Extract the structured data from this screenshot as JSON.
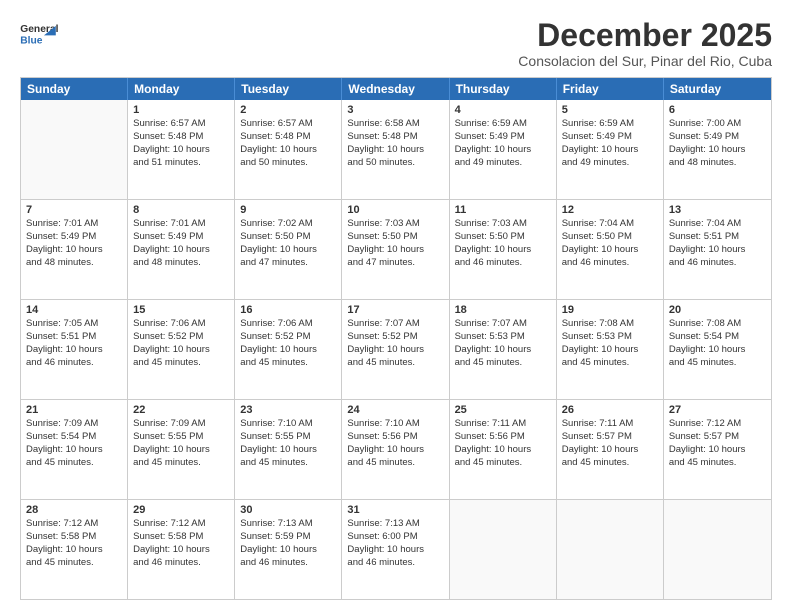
{
  "header": {
    "logo_general": "General",
    "logo_blue": "Blue",
    "title": "December 2025",
    "subtitle": "Consolacion del Sur, Pinar del Rio, Cuba"
  },
  "days_of_week": [
    "Sunday",
    "Monday",
    "Tuesday",
    "Wednesday",
    "Thursday",
    "Friday",
    "Saturday"
  ],
  "weeks": [
    [
      {
        "day": "",
        "empty": true
      },
      {
        "day": "1",
        "lines": [
          "Sunrise: 6:57 AM",
          "Sunset: 5:48 PM",
          "Daylight: 10 hours",
          "and 51 minutes."
        ]
      },
      {
        "day": "2",
        "lines": [
          "Sunrise: 6:57 AM",
          "Sunset: 5:48 PM",
          "Daylight: 10 hours",
          "and 50 minutes."
        ]
      },
      {
        "day": "3",
        "lines": [
          "Sunrise: 6:58 AM",
          "Sunset: 5:48 PM",
          "Daylight: 10 hours",
          "and 50 minutes."
        ]
      },
      {
        "day": "4",
        "lines": [
          "Sunrise: 6:59 AM",
          "Sunset: 5:49 PM",
          "Daylight: 10 hours",
          "and 49 minutes."
        ]
      },
      {
        "day": "5",
        "lines": [
          "Sunrise: 6:59 AM",
          "Sunset: 5:49 PM",
          "Daylight: 10 hours",
          "and 49 minutes."
        ]
      },
      {
        "day": "6",
        "lines": [
          "Sunrise: 7:00 AM",
          "Sunset: 5:49 PM",
          "Daylight: 10 hours",
          "and 48 minutes."
        ]
      }
    ],
    [
      {
        "day": "7",
        "lines": [
          "Sunrise: 7:01 AM",
          "Sunset: 5:49 PM",
          "Daylight: 10 hours",
          "and 48 minutes."
        ]
      },
      {
        "day": "8",
        "lines": [
          "Sunrise: 7:01 AM",
          "Sunset: 5:49 PM",
          "Daylight: 10 hours",
          "and 48 minutes."
        ]
      },
      {
        "day": "9",
        "lines": [
          "Sunrise: 7:02 AM",
          "Sunset: 5:50 PM",
          "Daylight: 10 hours",
          "and 47 minutes."
        ]
      },
      {
        "day": "10",
        "lines": [
          "Sunrise: 7:03 AM",
          "Sunset: 5:50 PM",
          "Daylight: 10 hours",
          "and 47 minutes."
        ]
      },
      {
        "day": "11",
        "lines": [
          "Sunrise: 7:03 AM",
          "Sunset: 5:50 PM",
          "Daylight: 10 hours",
          "and 46 minutes."
        ]
      },
      {
        "day": "12",
        "lines": [
          "Sunrise: 7:04 AM",
          "Sunset: 5:50 PM",
          "Daylight: 10 hours",
          "and 46 minutes."
        ]
      },
      {
        "day": "13",
        "lines": [
          "Sunrise: 7:04 AM",
          "Sunset: 5:51 PM",
          "Daylight: 10 hours",
          "and 46 minutes."
        ]
      }
    ],
    [
      {
        "day": "14",
        "lines": [
          "Sunrise: 7:05 AM",
          "Sunset: 5:51 PM",
          "Daylight: 10 hours",
          "and 46 minutes."
        ]
      },
      {
        "day": "15",
        "lines": [
          "Sunrise: 7:06 AM",
          "Sunset: 5:52 PM",
          "Daylight: 10 hours",
          "and 45 minutes."
        ]
      },
      {
        "day": "16",
        "lines": [
          "Sunrise: 7:06 AM",
          "Sunset: 5:52 PM",
          "Daylight: 10 hours",
          "and 45 minutes."
        ]
      },
      {
        "day": "17",
        "lines": [
          "Sunrise: 7:07 AM",
          "Sunset: 5:52 PM",
          "Daylight: 10 hours",
          "and 45 minutes."
        ]
      },
      {
        "day": "18",
        "lines": [
          "Sunrise: 7:07 AM",
          "Sunset: 5:53 PM",
          "Daylight: 10 hours",
          "and 45 minutes."
        ]
      },
      {
        "day": "19",
        "lines": [
          "Sunrise: 7:08 AM",
          "Sunset: 5:53 PM",
          "Daylight: 10 hours",
          "and 45 minutes."
        ]
      },
      {
        "day": "20",
        "lines": [
          "Sunrise: 7:08 AM",
          "Sunset: 5:54 PM",
          "Daylight: 10 hours",
          "and 45 minutes."
        ]
      }
    ],
    [
      {
        "day": "21",
        "lines": [
          "Sunrise: 7:09 AM",
          "Sunset: 5:54 PM",
          "Daylight: 10 hours",
          "and 45 minutes."
        ]
      },
      {
        "day": "22",
        "lines": [
          "Sunrise: 7:09 AM",
          "Sunset: 5:55 PM",
          "Daylight: 10 hours",
          "and 45 minutes."
        ]
      },
      {
        "day": "23",
        "lines": [
          "Sunrise: 7:10 AM",
          "Sunset: 5:55 PM",
          "Daylight: 10 hours",
          "and 45 minutes."
        ]
      },
      {
        "day": "24",
        "lines": [
          "Sunrise: 7:10 AM",
          "Sunset: 5:56 PM",
          "Daylight: 10 hours",
          "and 45 minutes."
        ]
      },
      {
        "day": "25",
        "lines": [
          "Sunrise: 7:11 AM",
          "Sunset: 5:56 PM",
          "Daylight: 10 hours",
          "and 45 minutes."
        ]
      },
      {
        "day": "26",
        "lines": [
          "Sunrise: 7:11 AM",
          "Sunset: 5:57 PM",
          "Daylight: 10 hours",
          "and 45 minutes."
        ]
      },
      {
        "day": "27",
        "lines": [
          "Sunrise: 7:12 AM",
          "Sunset: 5:57 PM",
          "Daylight: 10 hours",
          "and 45 minutes."
        ]
      }
    ],
    [
      {
        "day": "28",
        "lines": [
          "Sunrise: 7:12 AM",
          "Sunset: 5:58 PM",
          "Daylight: 10 hours",
          "and 45 minutes."
        ]
      },
      {
        "day": "29",
        "lines": [
          "Sunrise: 7:12 AM",
          "Sunset: 5:58 PM",
          "Daylight: 10 hours",
          "and 46 minutes."
        ]
      },
      {
        "day": "30",
        "lines": [
          "Sunrise: 7:13 AM",
          "Sunset: 5:59 PM",
          "Daylight: 10 hours",
          "and 46 minutes."
        ]
      },
      {
        "day": "31",
        "lines": [
          "Sunrise: 7:13 AM",
          "Sunset: 6:00 PM",
          "Daylight: 10 hours",
          "and 46 minutes."
        ]
      },
      {
        "day": "",
        "empty": true
      },
      {
        "day": "",
        "empty": true
      },
      {
        "day": "",
        "empty": true
      }
    ]
  ]
}
